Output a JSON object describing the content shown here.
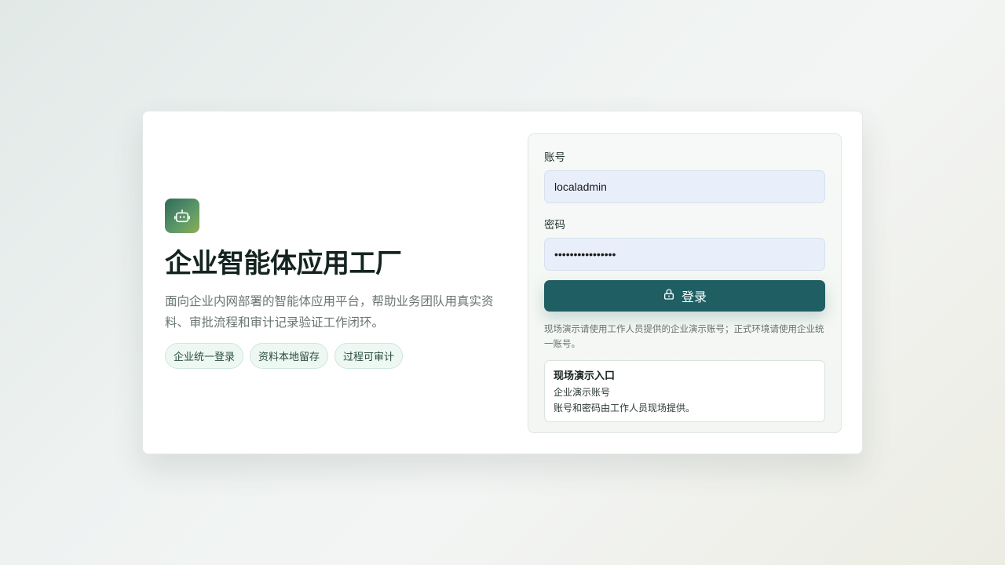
{
  "brand": {
    "logo_icon": "robot-icon",
    "title": "企业智能体应用工厂",
    "description": "面向企业内网部署的智能体应用平台，帮助业务团队用真实资料、审批流程和审计记录验证工作闭环。",
    "tags": [
      "企业统一登录",
      "资料本地留存",
      "过程可审计"
    ]
  },
  "login": {
    "account_label": "账号",
    "account_value": "localadmin",
    "password_label": "密码",
    "password_value": "••••••••••••••••",
    "submit_label": "登录",
    "submit_icon": "lock-icon",
    "note": "现场演示请使用工作人员提供的企业演示账号；正式环境请使用企业统一账号。"
  },
  "demo": {
    "title": "现场演示入口",
    "line1": "企业演示账号",
    "line2": "账号和密码由工作人员现场提供。"
  },
  "colors": {
    "primary": "#1f5f63",
    "tag_bg": "#eef8f3",
    "input_bg": "#e8effb"
  }
}
